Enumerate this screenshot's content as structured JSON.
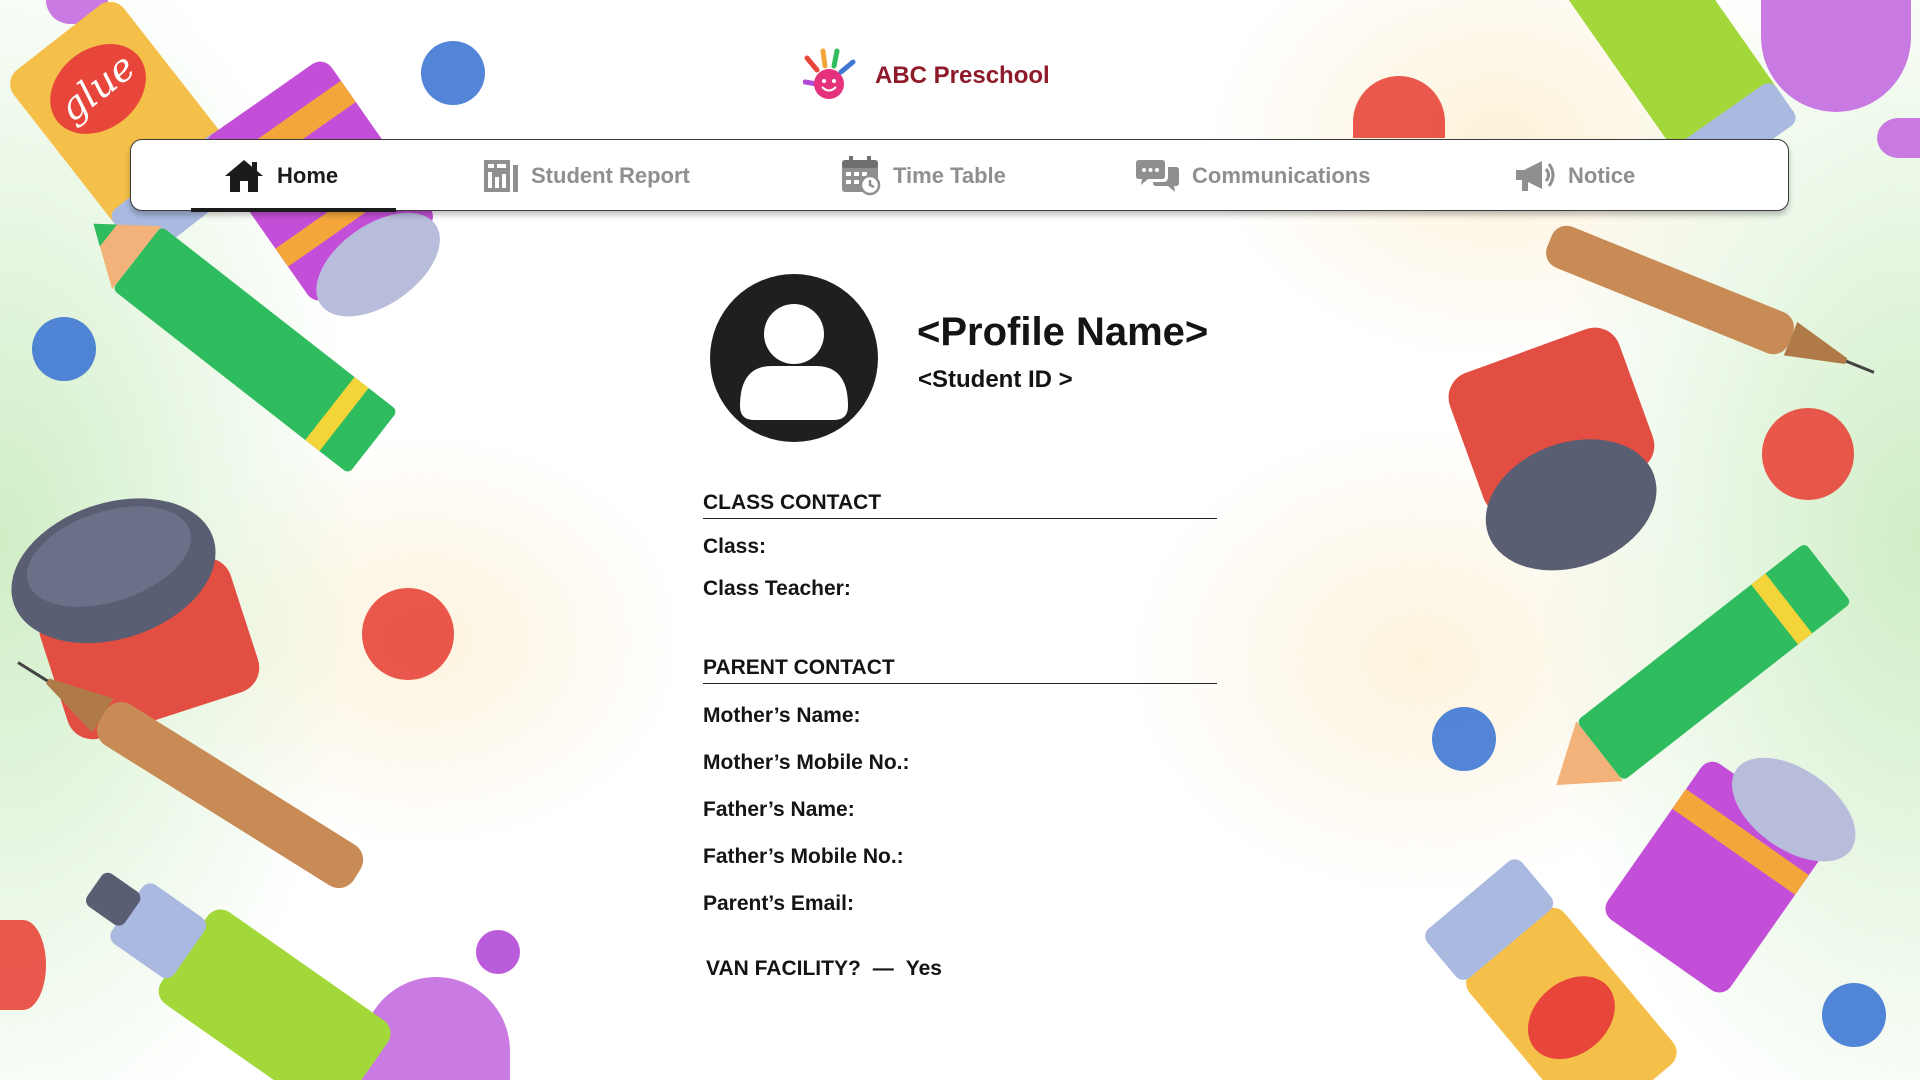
{
  "app": {
    "name": "ABC Preschool"
  },
  "nav": {
    "tabs": [
      {
        "label": "Home",
        "icon": "home-icon",
        "active": true
      },
      {
        "label": "Student Report",
        "icon": "report-icon",
        "active": false
      },
      {
        "label": "Time Table",
        "icon": "calendar-icon",
        "active": false
      },
      {
        "label": "Communications",
        "icon": "chat-icon",
        "active": false
      },
      {
        "label": "Notice",
        "icon": "megaphone-icon",
        "active": false
      }
    ]
  },
  "profile": {
    "name": "<Profile Name>",
    "student_id": "<Student ID >",
    "avatar_icon": "user-avatar-icon"
  },
  "class_contact": {
    "title": "CLASS CONTACT",
    "class_label": "Class:",
    "teacher_label": "Class Teacher:"
  },
  "parent_contact": {
    "title": "PARENT CONTACT",
    "mother_name_label": "Mother’s Name:",
    "mother_mobile_label": "Mother’s Mobile No.:",
    "father_name_label": "Father’s Name:",
    "father_mobile_label": "Father’s Mobile No.:",
    "email_label": "Parent’s Email:"
  },
  "van": {
    "label": "VAN FACILITY?",
    "separator": "—",
    "value": "Yes"
  },
  "decor": {
    "glue_text": "glue"
  },
  "colors": {
    "brand": "#8e1a2a",
    "active_text": "#1b1b1b",
    "inactive_text": "#8f8f8f",
    "nav_border": "#3a3a3a"
  }
}
